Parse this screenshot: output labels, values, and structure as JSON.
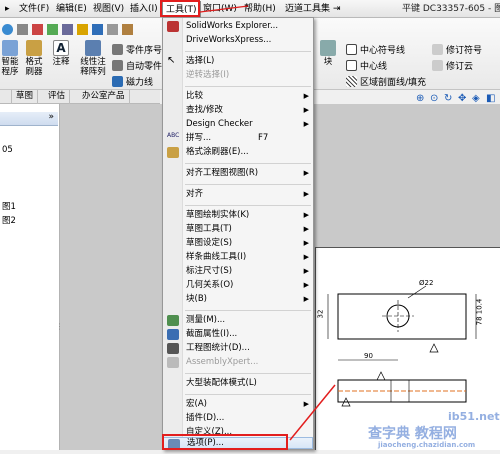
{
  "menubar": {
    "items": [
      "文件(F)",
      "编辑(E)",
      "视图(V)",
      "插入(I)",
      "工具(T)",
      "窗口(W)",
      "帮助(H)",
      "迈道工具集"
    ],
    "title": "平键 DC33357-605 - 图"
  },
  "ribbon": {
    "left_buttons": [
      "智能\n程序",
      "格式\n刷器",
      "注释",
      "线性注\n释阵列"
    ],
    "mid_rows": [
      "零件序号",
      "自动零件",
      "磁力线"
    ],
    "right_rows": [
      "中心符号线",
      "中心线",
      "区域剖面线/填充"
    ],
    "right_rows2": [
      "修订符号",
      "修订云"
    ],
    "block_label": "块"
  },
  "tabs": [
    "草图",
    "评估",
    "办公室产品"
  ],
  "left_panel": {
    "items": [
      "05",
      "图1",
      "图2"
    ]
  },
  "menu": {
    "items": [
      {
        "label": "SolidWorks Explorer...",
        "arrow": false
      },
      {
        "label": "DriveWorksXpress...",
        "arrow": false
      },
      {
        "label": "选择(L)",
        "arrow": false
      },
      {
        "label": "逆转选择(I)",
        "arrow": false,
        "disabled": true
      },
      {
        "label": "比较",
        "arrow": true
      },
      {
        "label": "查找/修改",
        "arrow": true
      },
      {
        "label": "Design Checker",
        "arrow": true
      },
      {
        "label": "拼写...",
        "shortcut": "F7"
      },
      {
        "label": "格式涂刷器(E)..."
      },
      {
        "label": "对齐工程图视图(R)",
        "arrow": true
      },
      {
        "label": "对齐",
        "arrow": true
      },
      {
        "label": "草图绘制实体(K)",
        "arrow": true
      },
      {
        "label": "草图工具(T)",
        "arrow": true
      },
      {
        "label": "草图设定(S)",
        "arrow": true
      },
      {
        "label": "样条曲线工具(I)",
        "arrow": true
      },
      {
        "label": "标注尺寸(S)",
        "arrow": true
      },
      {
        "label": "几何关系(O)",
        "arrow": true
      },
      {
        "label": "块(B)",
        "arrow": true
      },
      {
        "label": "测量(M)..."
      },
      {
        "label": "截面属性(I)..."
      },
      {
        "label": "工程图统计(D)..."
      },
      {
        "label": "AssemblyXpert...",
        "disabled": true
      },
      {
        "label": "大型装配体模式(L)"
      },
      {
        "label": "宏(A)",
        "arrow": true
      },
      {
        "label": "插件(D)..."
      },
      {
        "label": "自定义(Z)..."
      },
      {
        "label": "选项(P)..."
      }
    ]
  },
  "drawing": {
    "dim_top": "Ø22",
    "dim_left": "32",
    "dim_right": "78 10.4",
    "dim_bottom": "90"
  },
  "watermark": {
    "line1": "ib51.net",
    "line2": "查字典 教程网",
    "line3": "jiaocheng.chazidian.com"
  },
  "colors": {
    "highlight_red": "#e21e1e",
    "menu_bg": "#f5f5f5",
    "selection_blue": "#d7e6f7"
  }
}
